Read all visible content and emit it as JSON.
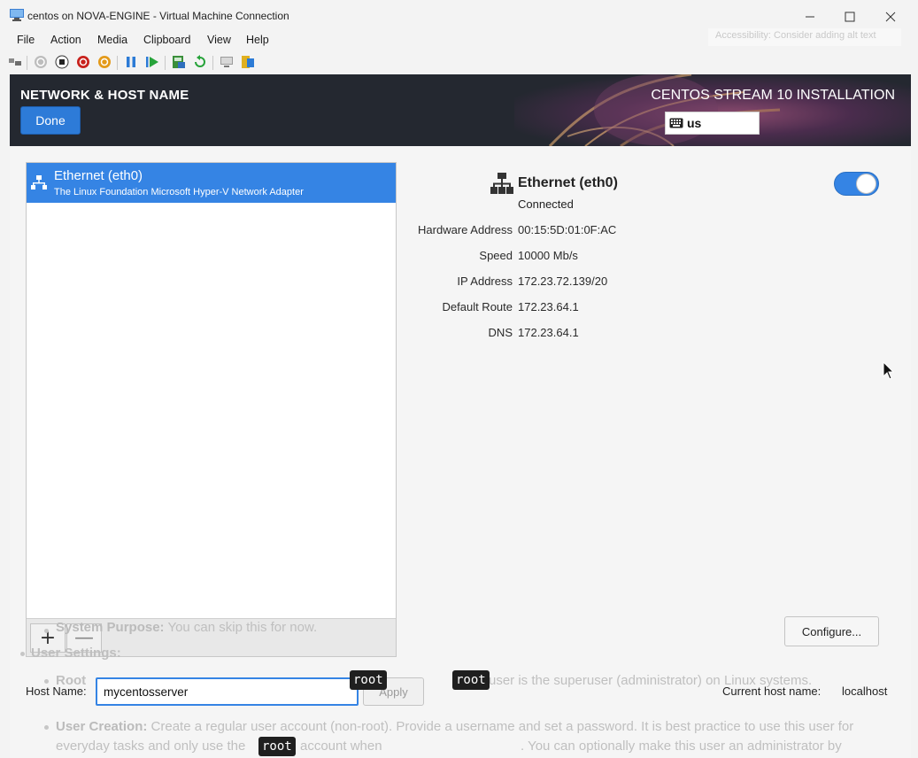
{
  "window": {
    "title": "centos on NOVA-ENGINE - Virtual Machine Connection",
    "accessibility_hint": "Accessibility: Consider adding alt text"
  },
  "menu": [
    "File",
    "Action",
    "Media",
    "Clipboard",
    "View",
    "Help"
  ],
  "installer": {
    "page_title": "NETWORK & HOST NAME",
    "done_label": "Done",
    "product_title": "CENTOS STREAM 10 INSTALLATION",
    "keyboard_layout": "us"
  },
  "device": {
    "name": "Ethernet (eth0)",
    "description": "The Linux Foundation Microsoft Hyper-V Network Adapter",
    "status": "Connected",
    "enabled": true
  },
  "details": [
    {
      "label": "Hardware Address",
      "value": "00:15:5D:01:0F:AC"
    },
    {
      "label": "Speed",
      "value": "10000 Mb/s"
    },
    {
      "label": "IP Address",
      "value": "172.23.72.139/20"
    },
    {
      "label": "Default Route",
      "value": "172.23.64.1"
    },
    {
      "label": "DNS",
      "value": "172.23.64.1"
    }
  ],
  "list_buttons": {
    "add": "+",
    "remove": "—"
  },
  "configure_label": "Configure...",
  "hostname": {
    "label": "Host Name:",
    "value": "mycentosserver",
    "apply_label": "Apply",
    "current_label": "Current host name:",
    "current_value": "localhost"
  },
  "overlay": {
    "purpose_bold": "System Purpose:",
    "purpose_text": " You can skip this for now.",
    "user_settings": "User Settings:",
    "root_bold": "Root",
    "root_line": "user is the superuser (administrator) on Linux systems.",
    "user_creation_bold": "User Creation:",
    "user_creation_text": " Create a regular user account (non-root). Provide a username and set a password. It is best practice to use this user for",
    "last_line_a": "everyday tasks and only use the",
    "last_line_b": "account when",
    "last_line_c": ". You can optionally make this user an administrator by",
    "tag_root": "root"
  }
}
